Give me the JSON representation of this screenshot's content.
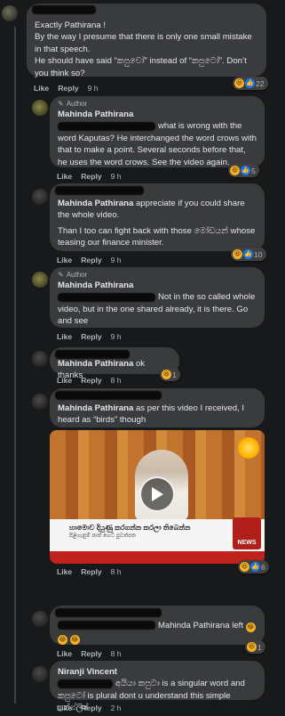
{
  "comments": [
    {
      "paragraphs": [
        "Exactly Pathirana !",
        "By the way I presume that there is only one small mistake in that speech.",
        "He should have said “කපුවෝ” instead of “කපුටෝ”. Don’t you think so?"
      ],
      "actions": {
        "like": "Like",
        "reply": "Reply",
        "time": "9 h"
      },
      "reaction_count": "22"
    },
    {
      "author_tag": "Author",
      "name": "Mahinda Pathirana",
      "text_after_redact": "what is wrong with the word Kaputas? He interchanged the word crows with that to make a point. Several seconds before that, he uses the word crows. See the video again.",
      "actions": {
        "like": "Like",
        "reply": "Reply",
        "time": "9 h"
      },
      "reaction_count": "5"
    },
    {
      "name_inline": "Mahinda Pathirana",
      "text_after_name": "appreciate if you could share the whole video.",
      "paragraph2": "Than I too can fight back with those මෝඩයන් whose teasing our finance minister.",
      "actions": {
        "like": "Like",
        "reply": "Reply",
        "time": "9 h"
      },
      "reaction_count": "10"
    },
    {
      "author_tag": "Author",
      "name": "Mahinda Pathirana",
      "text_after_redact": "Not in the so called whole video, but in the one shared already, it is there. Go and see",
      "actions": {
        "like": "Like",
        "reply": "Reply",
        "time": "9 h"
      }
    },
    {
      "name_inline": "Mahinda Pathirana",
      "text_after_name": "ok thanks",
      "actions": {
        "like": "Like",
        "reply": "Reply",
        "time": "8 h"
      },
      "reaction_count": "1"
    },
    {
      "name_inline": "Mahinda Pathirana",
      "text_after_name": "as per this video I received, I heard as “birds” though",
      "video": {
        "banner_line1": "හාමොව දියුණු කරගන්න කරලා තිබෙන්න",
        "banner_line2": "පිළිගැනුම් ජාත් හෙට පුවත්පත",
        "logo": "NEWS"
      },
      "actions": {
        "like": "Like",
        "reply": "Reply",
        "time": "8 h"
      },
      "reaction_count": "6"
    },
    {
      "text_after_redact": "Mahinda Pathirana left",
      "actions": {
        "like": "Like",
        "reply": "Reply",
        "time": "8 h"
      },
      "reaction_count": "1"
    },
    {
      "name": "Niranji Vincent",
      "text_after_redact": "අයියා කපුටා is a singular word and කපුටෝ is plural dont u understand this simple ඉන්ග්ලිෂ්",
      "actions": {
        "like": "Like",
        "reply": "Reply",
        "time": "2 h"
      }
    }
  ],
  "colors": {
    "background": "#18191a",
    "bubble": "#3a3b3c",
    "text": "#e4e6eb",
    "muted": "#b0b3b8",
    "haha": "#f7b125",
    "like": "#1877f2"
  }
}
